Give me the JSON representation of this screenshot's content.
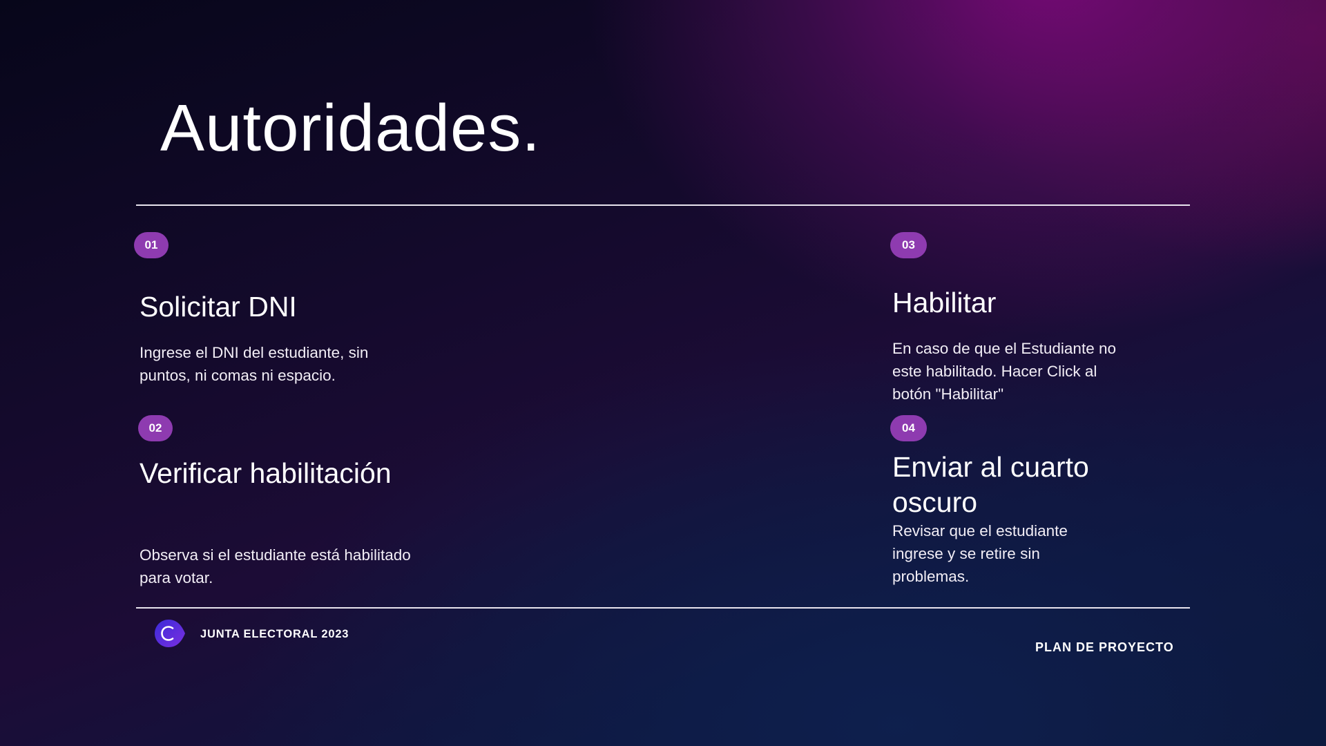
{
  "slide": {
    "title": "Autoridades."
  },
  "steps": [
    {
      "number": "01",
      "title": "Solicitar DNI",
      "description": "Ingrese el DNI del estudiante, sin puntos, ni comas ni espacio."
    },
    {
      "number": "02",
      "title": "Verificar habilitación",
      "description": "Observa si el estudiante está habilitado para votar."
    },
    {
      "number": "03",
      "title": "Habilitar",
      "description": "En caso de que el Estudiante no este habilitado. Hacer Click al botón \"Habilitar\""
    },
    {
      "number": "04",
      "title": "Enviar al cuarto oscuro",
      "description": "Revisar que el estudiante ingrese y se retire sin problemas."
    }
  ],
  "footer": {
    "brand": "JUNTA ELECTORAL 2023",
    "logo_icon": "c-circle-logo-icon",
    "right_label": "PLAN DE PROYECTO"
  },
  "colors": {
    "badge": "#8e3bb0",
    "rule": "#e8e4ee",
    "logo": "#5b2bd6"
  }
}
